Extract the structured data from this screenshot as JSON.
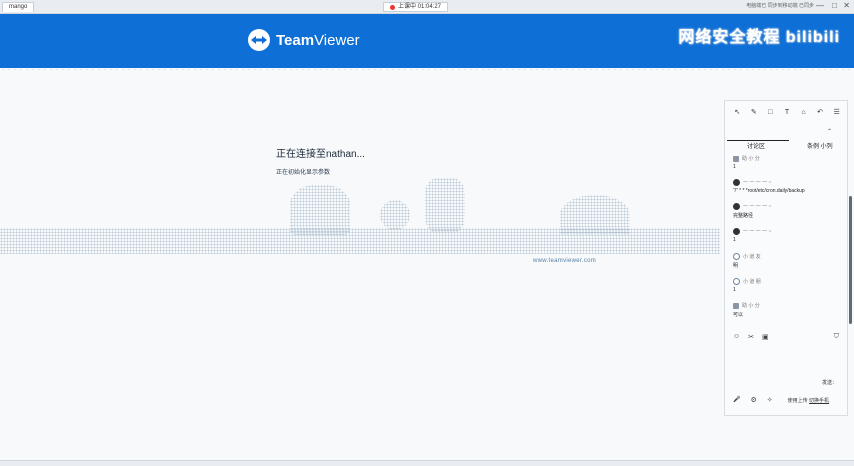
{
  "window": {
    "tab_label": "mango",
    "recording_label": "上课中 01:04:27",
    "top_right_text": "电脑端已 同步到移动端 已同步",
    "min": "—",
    "max": "□",
    "close": "✕"
  },
  "header": {
    "brand_bold": "Team",
    "brand_thin": "Viewer",
    "watermark": "网络安全教程 bilibili"
  },
  "connection": {
    "title": "正在连接至nathan...",
    "subtitle": "正在初始化显示参数",
    "web_link": "www.teamviewer.com"
  },
  "panel": {
    "tools": [
      "↖",
      "✎",
      "□",
      "T",
      "⌂",
      "↶",
      "☰"
    ],
    "tabs": {
      "discussion": "讨论区",
      "list": "条例 小列"
    },
    "pin": "⌃",
    "messages": [
      {
        "name": "助 小 分",
        "body": "1"
      },
      {
        "name": "一 一 一 一 ~",
        "body": "“/” * * *root/etc/cron.daily/backup"
      },
      {
        "name": "一 一 一 一 ~",
        "body": "完整路径"
      },
      {
        "name": "一 一 一 一 ~",
        "body": "1"
      },
      {
        "name": "小 道 友",
        "body": "明"
      },
      {
        "name": "小 道 朋",
        "body": "1"
      },
      {
        "name": "助 小 分",
        "body": "可以"
      }
    ],
    "icons": {
      "smile": "☺",
      "scissors": "✂",
      "image": "▣",
      "shield": "⛉"
    },
    "send_label": "发送：",
    "bottom_icons": {
      "mic": "🎤",
      "gear": "⚙",
      "wand": "✧"
    },
    "bottom_right": "使用上传 ",
    "bottom_right_link": "切换手机"
  }
}
